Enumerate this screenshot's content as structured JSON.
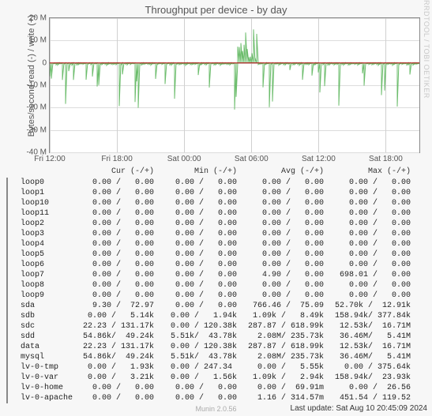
{
  "chart_data": {
    "type": "line",
    "title": "Throughput per device - by day",
    "ylabel": "Bytes/second read (-) / write (+)",
    "xticks": [
      "Fri 12:00",
      "Fri 18:00",
      "Sat 00:00",
      "Sat 06:00",
      "Sat 12:00",
      "Sat 18:00"
    ],
    "yticks": [
      "-40 M",
      "-30 M",
      "-20 M",
      "-10 M",
      "0",
      "10 M",
      "20 M"
    ],
    "ylim": [
      -40000000,
      20000000
    ],
    "watermark": "RRDTOOL / TOBI OETIKER",
    "generator": "Munin 2.0.56",
    "last_update": "Last update: Sat Aug 10 20:45:09 2024",
    "legend_headers": [
      "Cur (-/+)",
      "Min (-/+)",
      "Avg (-/+)",
      "Max (-/+)"
    ],
    "series": [
      {
        "name": "loop0",
        "color": "#00c800",
        "cur": "0.00 /   0.00",
        "min": "0.00 /   0.00",
        "avg": "0.00 /   0.00",
        "max": "0.00 /   0.00"
      },
      {
        "name": "loop1",
        "color": "#0050ff",
        "cur": "0.00 /   0.00",
        "min": "0.00 /   0.00",
        "avg": "0.00 /   0.00",
        "max": "0.00 /   0.00"
      },
      {
        "name": "loop10",
        "color": "#ff8c00",
        "cur": "0.00 /   0.00",
        "min": "0.00 /   0.00",
        "avg": "0.00 /   0.00",
        "max": "0.00 /   0.00"
      },
      {
        "name": "loop11",
        "color": "#c86400",
        "cur": "0.00 /   0.00",
        "min": "0.00 /   0.00",
        "avg": "0.00 /   0.00",
        "max": "0.00 /   0.00"
      },
      {
        "name": "loop2",
        "color": "#6a0dad",
        "cur": "0.00 /   0.00",
        "min": "0.00 /   0.00",
        "avg": "0.00 /   0.00",
        "max": "0.00 /   0.00"
      },
      {
        "name": "loop3",
        "color": "#00c8c8",
        "cur": "0.00 /   0.00",
        "min": "0.00 /   0.00",
        "avg": "0.00 /   0.00",
        "max": "0.00 /   0.00"
      },
      {
        "name": "loop4",
        "color": "#e0e000",
        "cur": "0.00 /   0.00",
        "min": "0.00 /   0.00",
        "avg": "0.00 /   0.00",
        "max": "0.00 /   0.00"
      },
      {
        "name": "loop5",
        "color": "#ff0000",
        "cur": "0.00 /   0.00",
        "min": "0.00 /   0.00",
        "avg": "0.00 /   0.00",
        "max": "0.00 /   0.00"
      },
      {
        "name": "loop6",
        "color": "#780000",
        "cur": "0.00 /   0.00",
        "min": "0.00 /   0.00",
        "avg": "0.00 /   0.00",
        "max": "0.00 /   0.00"
      },
      {
        "name": "loop7",
        "color": "#005000",
        "cur": "0.00 /   0.00",
        "min": "0.00 /   0.00",
        "avg": "4.90 /   0.00",
        "max": "698.01 /   0.00"
      },
      {
        "name": "loop8",
        "color": "#3c783c",
        "cur": "0.00 /   0.00",
        "min": "0.00 /   0.00",
        "avg": "0.00 /   0.00",
        "max": "0.00 /   0.00"
      },
      {
        "name": "loop9",
        "color": "#3c3c78",
        "cur": "0.00 /   0.00",
        "min": "0.00 /   0.00",
        "avg": "0.00 /   0.00",
        "max": "0.00 /   0.00"
      },
      {
        "name": "sda",
        "color": "#8f7300",
        "cur": "9.30 /  72.97",
        "min": "0.00 /   0.00",
        "avg": "766.46 /  75.09",
        "max": "52.70k /  12.91k"
      },
      {
        "name": "sdb",
        "color": "#787878",
        "cur": "0.00 /   5.14k",
        "min": "0.00 /   1.94k",
        "avg": "1.09k /   8.49k",
        "max": "158.94k/ 377.84k"
      },
      {
        "name": "sdc",
        "color": "#ff7070",
        "cur": "22.23 / 131.17k",
        "min": "0.00 / 120.38k",
        "avg": "287.87 / 618.99k",
        "max": "12.53k/  16.71M"
      },
      {
        "name": "sdd",
        "color": "#70ff70",
        "cur": "54.86k/  49.24k",
        "min": "5.51k/  43.78k",
        "avg": "2.08M/ 235.73k",
        "max": "36.46M/   5.41M"
      },
      {
        "name": "data",
        "color": "#7070ff",
        "cur": "22.23 / 131.17k",
        "min": "0.00 / 120.38k",
        "avg": "287.87 / 618.99k",
        "max": "12.53k/  16.71M"
      },
      {
        "name": "mysql",
        "color": "#a0ffa0",
        "cur": "54.86k/  49.24k",
        "min": "5.51k/  43.78k",
        "avg": "2.08M/ 235.73k",
        "max": "36.46M/   5.41M"
      },
      {
        "name": "lv-0-tmp",
        "color": "#a0c8ff",
        "cur": "0.00 /   1.93k",
        "min": "0.00 / 247.34 ",
        "avg": "0.00 /   5.55k",
        "max": "0.00 / 375.64k"
      },
      {
        "name": "lv-0-var",
        "color": "#ffc8a0",
        "cur": "0.00 /   3.21k",
        "min": "0.00 /   1.56k",
        "avg": "1.09k /   2.94k",
        "max": "158.94k/  23.93k"
      },
      {
        "name": "lv-0-home",
        "color": "#c0a0ff",
        "cur": "0.00 /   0.00",
        "min": "0.00 /   0.00",
        "avg": "0.00 /  69.91m",
        "max": "0.00 /  26.56"
      },
      {
        "name": "lv-0-apache",
        "color": "#8c00c8",
        "cur": "0.00 /   0.00",
        "min": "0.00 /   0.00",
        "avg": "1.16 / 314.57m",
        "max": "451.54 / 119.52"
      }
    ]
  }
}
